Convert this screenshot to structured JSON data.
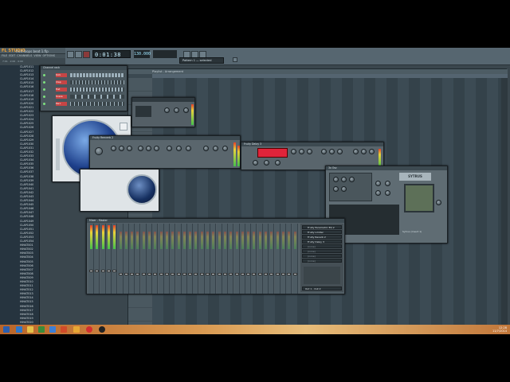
{
  "app": {
    "logo": "FL STUDIO",
    "project_name": "fruit loops beat 1.flp",
    "menu": [
      "FILE",
      "EDIT",
      "CHANNELS",
      "VIEW",
      "OPTIONS",
      "TOOLS",
      "HELP"
    ],
    "status": "7:01 · 2:00 · 0:00"
  },
  "toolbar": {
    "time": "0:01:38",
    "tempo": "130.000",
    "pattern": "Pattern 1 — selected"
  },
  "browser": {
    "items": [
      "CLAP1011",
      "CLAP1012",
      "CLAP1013",
      "CLAP1014",
      "CLAP1015",
      "CLAP1016",
      "CLAP1017",
      "CLAP1018",
      "CLAP1019",
      "CLAP1020",
      "CLAP1021",
      "CLAP1022",
      "CLAP1023",
      "CLAP1024",
      "CLAP1025",
      "CLAP1026",
      "CLAP1027",
      "CLAP1028",
      "CLAP1029",
      "CLAP1030",
      "CLAP1031",
      "CLAP1032",
      "CLAP1033",
      "CLAP1034",
      "CLAP1035",
      "CLAP1036",
      "CLAP1037",
      "CLAP1038",
      "CLAP1039",
      "CLAP1040",
      "CLAP1041",
      "CLAP1042",
      "CLAP1043",
      "CLAP1044",
      "CLAP1045",
      "CLAP1046",
      "CLAP1047",
      "CLAP1048",
      "CLAP1049",
      "CLAP1050",
      "CLAP1051",
      "CLAP1052",
      "CLAP1053",
      "CLAP1054",
      "HIHAT001",
      "HIHAT002",
      "HIHAT003",
      "HIHAT004",
      "HIHAT005",
      "HIHAT006",
      "HIHAT007",
      "HIHAT008",
      "HIHAT009",
      "HIHAT010",
      "HIHAT011",
      "HIHAT012",
      "HIHAT013",
      "HIHAT014",
      "HIHAT015",
      "HIHAT016",
      "HIHAT017",
      "HIHAT018",
      "HIHAT019",
      "HIHAT020"
    ]
  },
  "playlist": {
    "title": "Playlist - Arrangement"
  },
  "channel_rack": {
    "title": "Channel rack",
    "channels": [
      "Kick",
      "Clap",
      "Hat",
      "Snare",
      "Perc"
    ]
  },
  "mixer": {
    "title": "Mixer - Master",
    "inserts": [
      "Fruity Parametric EQ 2",
      "Fruity Limiter",
      "Fruity Reverb 2",
      "Fruity Delay 3",
      "(none)",
      "(none)",
      "(none)",
      "(none)"
    ],
    "output": "Out 1 - Out 2"
  },
  "plugins": {
    "reverb_title": "Fruity Reeverb 2",
    "delay_title": "Fruity Delay 3",
    "synth_title": "3x Osc",
    "synth_brand": "SYTRUS",
    "synth_footer": "Sytrus (Insert 1)"
  },
  "colors": {
    "accent_red": "#e0243a",
    "meter_green": "#44c24a",
    "logo_orange": "#f0a030"
  },
  "taskbar": {
    "time": "12:28",
    "date": "11/7/2014"
  }
}
